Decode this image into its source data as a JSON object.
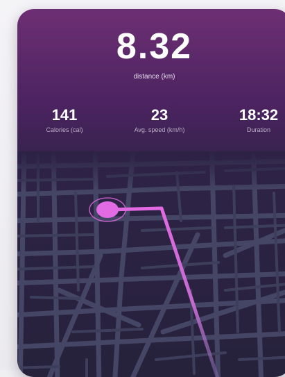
{
  "summary": {
    "distance_value": "8.32",
    "distance_label": "distance (km)"
  },
  "stats": {
    "calories": {
      "value": "141",
      "label": "Calories (cal)"
    },
    "speed": {
      "value": "23",
      "label": "Avg. speed (km/h)"
    },
    "duration": {
      "value": "18:32",
      "label": "Duration"
    }
  },
  "colors": {
    "accent": "#e26ae3",
    "card_top": "#6d2f73",
    "card_bottom": "#26223b",
    "road": "#454665"
  },
  "icons": {
    "location_marker": "location-marker-icon"
  }
}
